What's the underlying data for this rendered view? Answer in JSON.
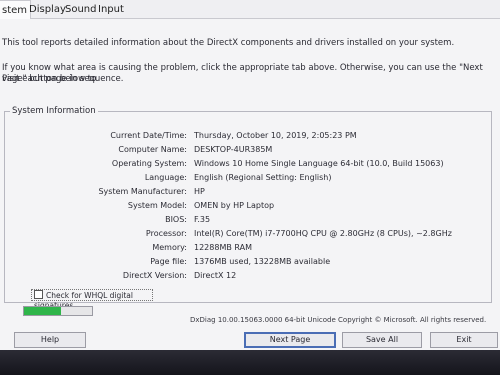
{
  "tabs": [
    "stem",
    "Display",
    "Sound",
    "Input"
  ],
  "intro": {
    "line1": "This tool reports detailed information about the DirectX components and drivers installed on your system.",
    "line2": "If you know what area is causing the problem, click the appropriate tab above.  Otherwise, you can use the \"Next Page\" button below to",
    "line3": "visit each page in sequence."
  },
  "system_info": {
    "title": "System Information",
    "rows": [
      {
        "label": "Current Date/Time:",
        "value": "Thursday, October 10, 2019, 2:05:23 PM"
      },
      {
        "label": "Computer Name:",
        "value": "DESKTOP-4UR385M"
      },
      {
        "label": "Operating System:",
        "value": "Windows 10 Home Single Language 64-bit (10.0, Build 15063)"
      },
      {
        "label": "Language:",
        "value": "English (Regional Setting: English)"
      },
      {
        "label": "System Manufacturer:",
        "value": "HP"
      },
      {
        "label": "System Model:",
        "value": "OMEN by HP Laptop"
      },
      {
        "label": "BIOS:",
        "value": "F.35"
      },
      {
        "label": "Processor:",
        "value": "Intel(R) Core(TM) i7-7700HQ CPU @ 2.80GHz (8 CPUs), ~2.8GHz"
      },
      {
        "label": "Memory:",
        "value": "12288MB RAM"
      },
      {
        "label": "Page file:",
        "value": "1376MB used, 13228MB available"
      },
      {
        "label": "DirectX Version:",
        "value": "DirectX 12"
      }
    ]
  },
  "whql_checkbox": {
    "label": "Check for WHQL digital signatures",
    "checked": false
  },
  "progress": {
    "fraction": 0.55,
    "color": "#2fb54a"
  },
  "footer_text": "DxDiag 10.00.15063.0000 64-bit Unicode  Copyright © Microsoft. All rights reserved.",
  "buttons": {
    "help": "Help",
    "next_page": "Next Page",
    "save_all": "Save All Information...",
    "exit": "Exit"
  }
}
